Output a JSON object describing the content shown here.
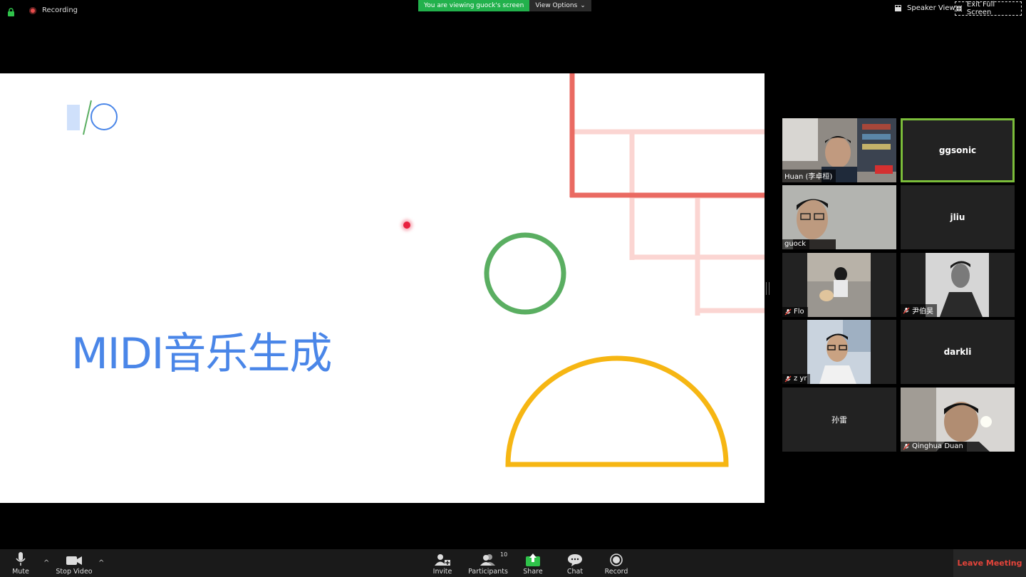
{
  "topbar": {
    "recording_label": "Recording",
    "sharing_notice": "You are viewing guock's screen",
    "view_options_label": "View Options",
    "speaker_view_label": "Speaker View",
    "exit_fullscreen_label": "Exit Full Screen"
  },
  "slide": {
    "title": "MIDI音乐生成"
  },
  "participants": [
    {
      "name": "Huan (李卓桓)",
      "video": true,
      "muted": false
    },
    {
      "name": "ggsonic",
      "video": false,
      "muted": false,
      "active_speaker": true
    },
    {
      "name": "guock",
      "video": true,
      "muted": false
    },
    {
      "name": "jliu",
      "video": false,
      "muted": false
    },
    {
      "name": "Flo",
      "video": true,
      "muted": true
    },
    {
      "name": "尹伯昊",
      "video": true,
      "muted": true
    },
    {
      "name": "z yr",
      "video": true,
      "muted": true
    },
    {
      "name": "darkli",
      "video": false,
      "muted": false
    },
    {
      "name": "孙雷",
      "video": false,
      "muted": false
    },
    {
      "name": "Qinghua Duan",
      "video": true,
      "muted": true
    }
  ],
  "toolbar": {
    "mute_label": "Mute",
    "stop_video_label": "Stop Video",
    "invite_label": "Invite",
    "participants_label": "Participants",
    "participants_count": "10",
    "share_label": "Share",
    "chat_label": "Chat",
    "record_label": "Record",
    "leave_label": "Leave Meeting"
  },
  "colors": {
    "share_green": "#22b14c",
    "active_speaker": "#7bbd3a",
    "leave_red": "#e5443a",
    "slide_blue": "#4a86e8",
    "slide_green": "#5aae61",
    "slide_yellow": "#f6b613",
    "slide_red": "#ea6a62"
  }
}
